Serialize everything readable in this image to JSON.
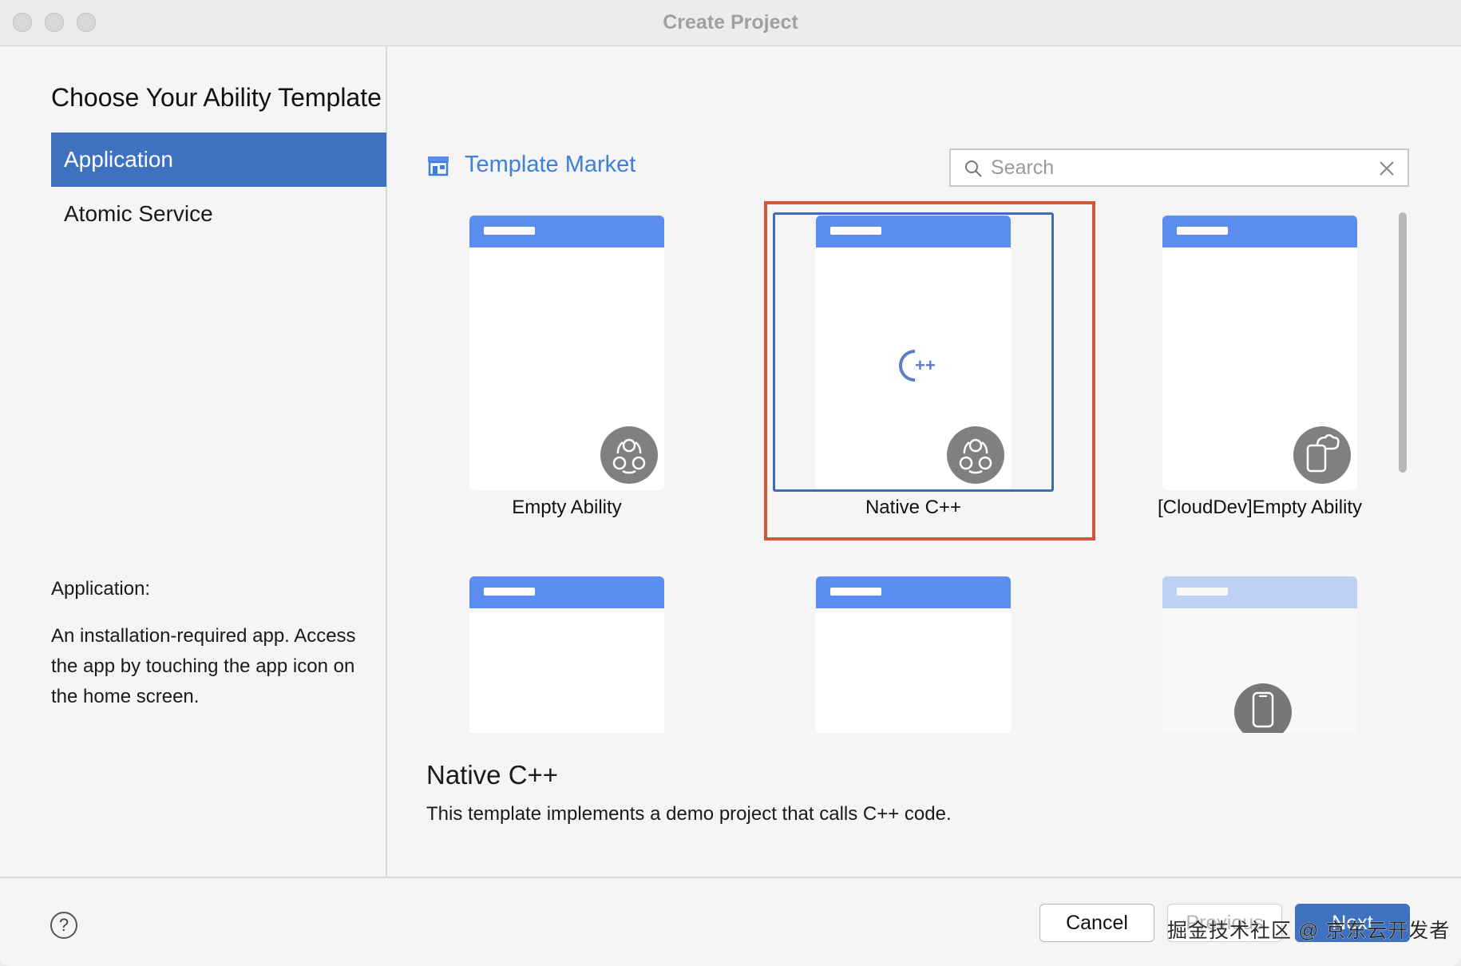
{
  "window": {
    "title": "Create Project"
  },
  "heading": "Choose Your Ability Template",
  "sidebar": {
    "items": [
      {
        "label": "Application",
        "selected": true
      },
      {
        "label": "Atomic Service",
        "selected": false
      }
    ],
    "description_title": "Application:",
    "description": "An installation-required app. Access the app by touching the app icon on the home screen."
  },
  "market": {
    "label": "Template Market",
    "icon": "store-icon"
  },
  "search": {
    "placeholder": "Search",
    "value": ""
  },
  "templates": [
    {
      "label": "Empty Ability",
      "badge_icon": "components-icon"
    },
    {
      "label": "Native C++",
      "badge_icon": "components-icon",
      "preview_icon": "cpp-logo-icon",
      "selected": true
    },
    {
      "label": "[CloudDev]Empty Ability",
      "badge_icon": "cloud-device-icon"
    },
    {
      "label": ""
    },
    {
      "label": ""
    },
    {
      "label": "",
      "badge_icon": "phone-icon"
    }
  ],
  "cpp_logo_text": "C++",
  "detail": {
    "title": "Native C++",
    "description": "This template implements a demo project that calls C++ code."
  },
  "footer": {
    "help_label": "?",
    "cancel_label": "Cancel",
    "previous_label": "Previous",
    "next_label": "Next"
  },
  "watermark": "掘金技术社区 @ 京东云开发者",
  "colors": {
    "accent": "#3e72c1",
    "card_header": "#5b8ef0",
    "highlight": "#d4553a",
    "link": "#3f7fd9"
  }
}
